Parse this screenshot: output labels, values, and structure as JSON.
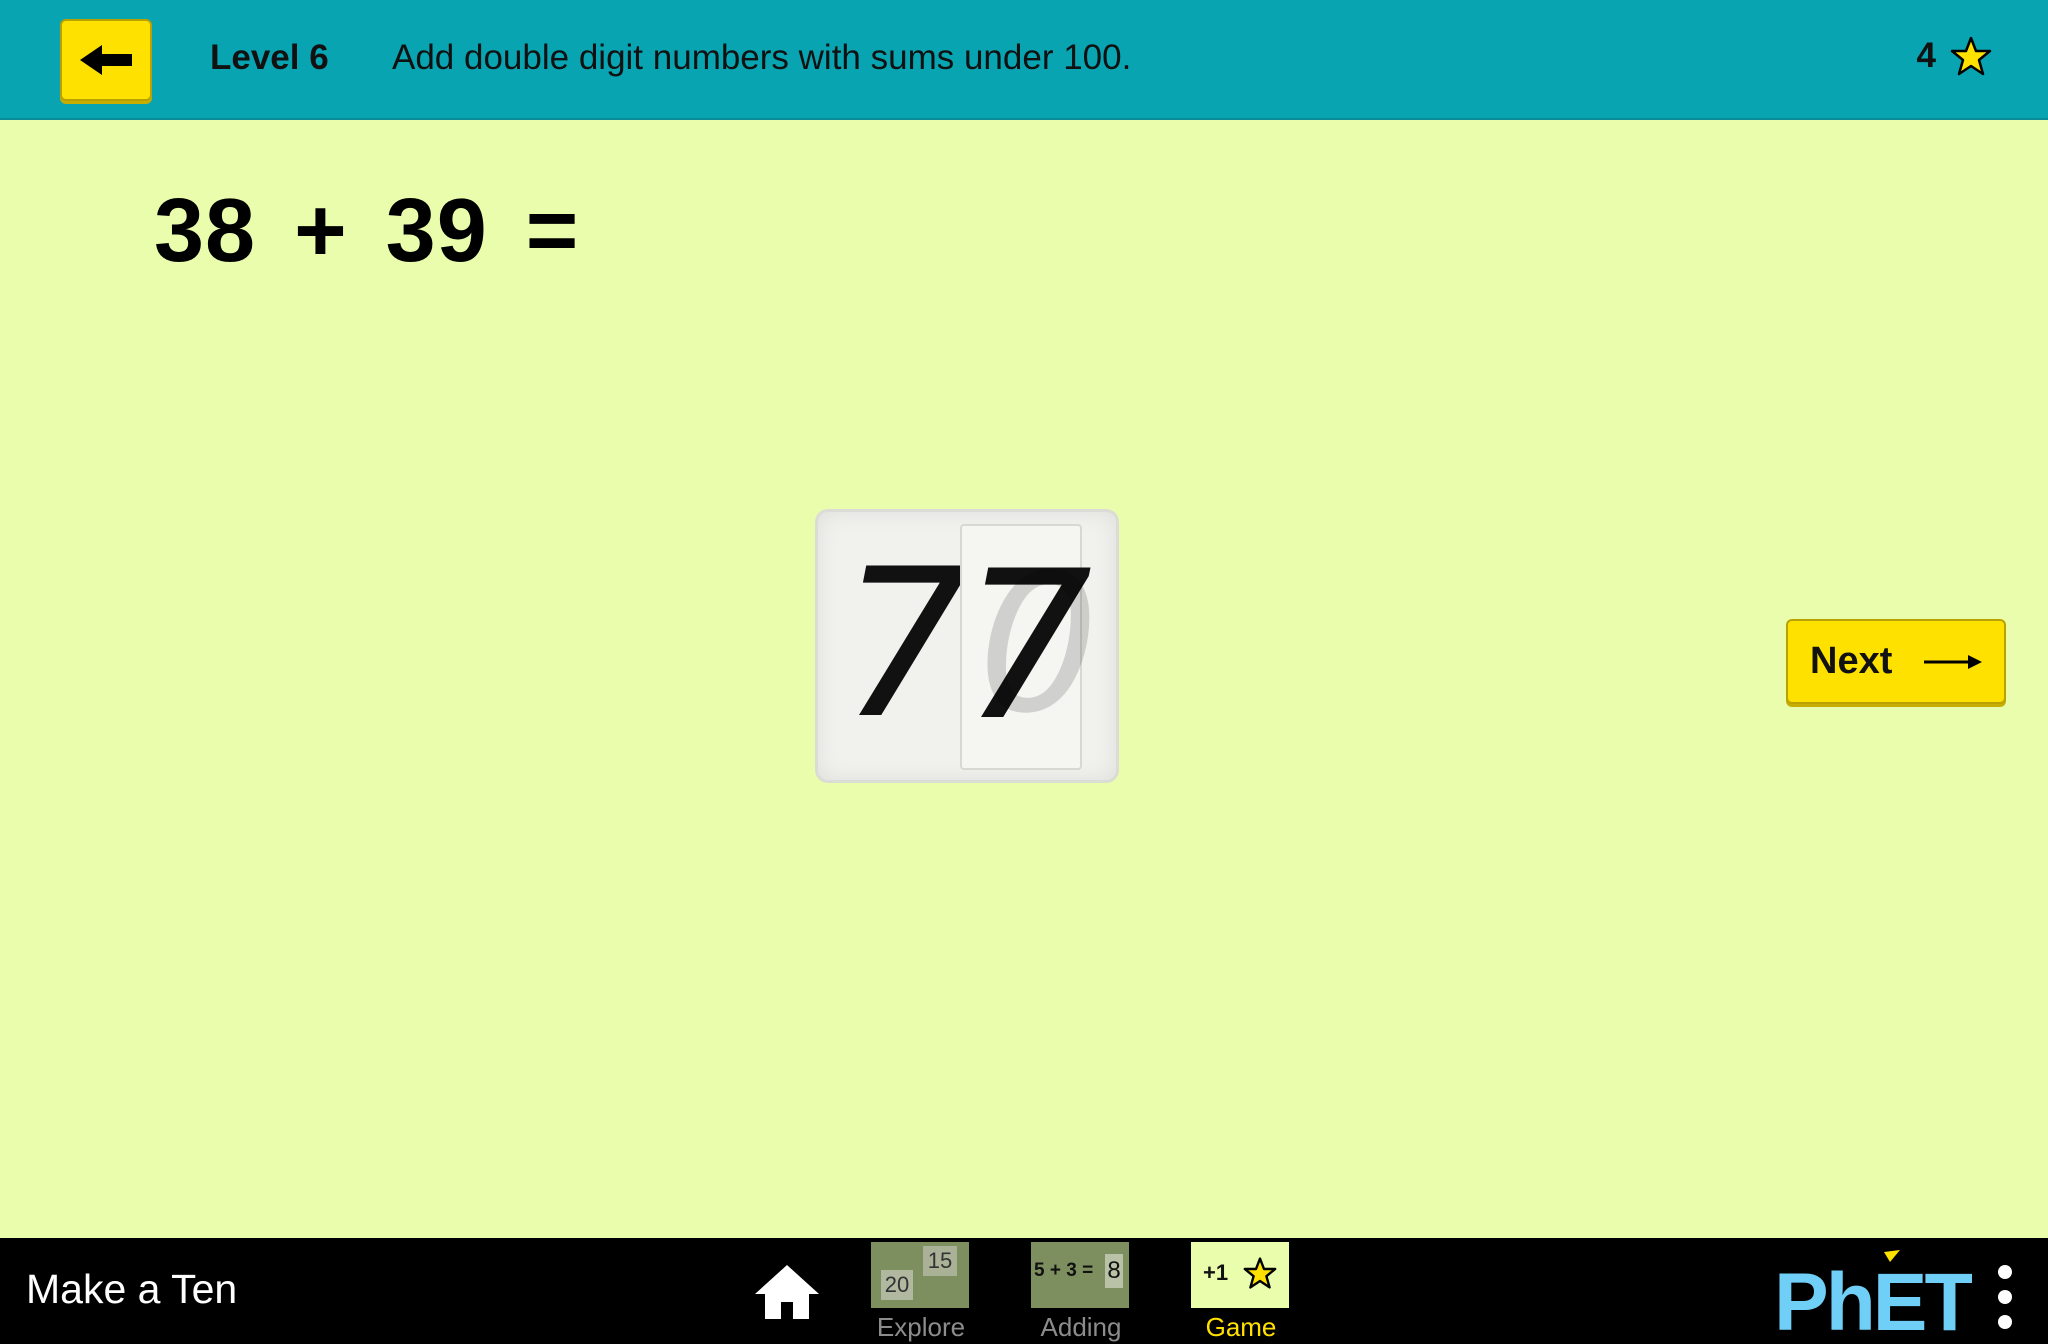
{
  "header": {
    "back_label": "",
    "level": "Level 6",
    "description": "Add double digit numbers with sums under 100.",
    "score": "4"
  },
  "equation": {
    "left": "38",
    "operator": "+",
    "right": "39",
    "equals": "="
  },
  "answer": {
    "digit_tens": "7",
    "digit_ones": "7",
    "ghost_digit": "0"
  },
  "next_button": {
    "label": "Next"
  },
  "nav": {
    "sim_title": "Make a Ten",
    "screens": [
      {
        "label": "Explore",
        "thumb_a": "20",
        "thumb_b": "15"
      },
      {
        "label": "Adding",
        "thumb_expr": "5 + 3 =",
        "thumb_result": "8"
      },
      {
        "label": "Game",
        "thumb_text": "+1",
        "active": true
      }
    ],
    "logo_text": "PhET"
  },
  "colors": {
    "header_bg": "#08a4b2",
    "play_area_bg": "#e9fdad",
    "button_yellow": "#ffe100",
    "navbar_bg": "#000000",
    "active_tab": "#ffe100",
    "phet_blue": "#6fcff6"
  },
  "icons": {
    "back": "arrow-left-icon",
    "score": "star-icon",
    "next": "arrow-right-icon",
    "home": "home-icon",
    "menu": "vertical-dots-icon"
  }
}
